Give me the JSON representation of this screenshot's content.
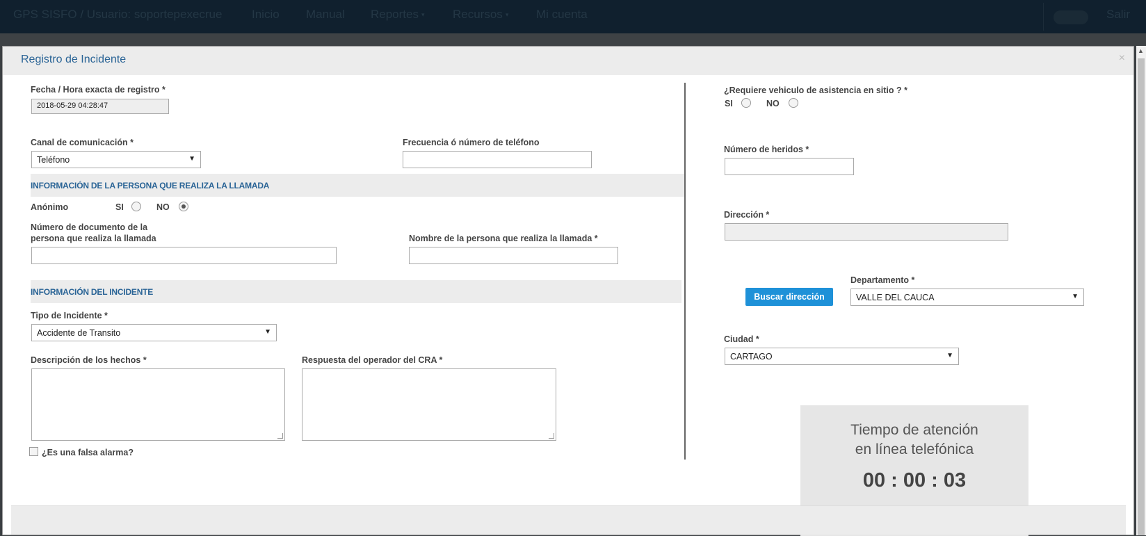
{
  "navbar": {
    "brand": "GPS SISFO / Usuario: soportepexecrue",
    "items": [
      "Inicio",
      "Manual",
      "Reportes",
      "Recursos",
      "Mi cuenta"
    ],
    "logout": "Salir"
  },
  "modal": {
    "title": "Registro de Incidente",
    "close": "×"
  },
  "form": {
    "fecha_label": "Fecha / Hora exacta de registro *",
    "fecha_value": "2018-05-29 04:28:47",
    "canal_label": "Canal de comunicación *",
    "canal_value": "Teléfono",
    "frecuencia_label": "Frecuencia ó número de teléfono",
    "section_persona": "INFORMACIÓN DE LA PERSONA QUE REALIZA LA LLAMADA",
    "anonimo_label": "Anónimo",
    "si": "SI",
    "no": "NO",
    "doc_label": "Número de documento de la persona que realiza la llamada",
    "nombre_label": "Nombre de la persona que realiza la llamada *",
    "section_incidente": "INFORMACIÓN DEL INCIDENTE",
    "tipo_label": "Tipo de Incidente *",
    "tipo_value": "Accidente de Transito",
    "descripcion_label": "Descripción de los hechos *",
    "respuesta_label": "Respuesta del operador del CRA *",
    "falsa_alarma_label": "¿Es una falsa alarma?",
    "vehiculo_label": "¿Requiere vehiculo de asistencia en sitio ? *",
    "heridos_label": "Número de heridos *",
    "direccion_label": "Dirección *",
    "buscar_button": "Buscar dirección",
    "departamento_label": "Departamento *",
    "departamento_value": "VALLE DEL CAUCA",
    "ciudad_label": "Ciudad *",
    "ciudad_value": "CARTAGO"
  },
  "timer": {
    "title_line1": "Tiempo de atención",
    "title_line2": "en línea telefónica",
    "value": "00 : 00 : 03"
  },
  "icons": {
    "dropdown": "▼",
    "scroll_up": "▲"
  }
}
